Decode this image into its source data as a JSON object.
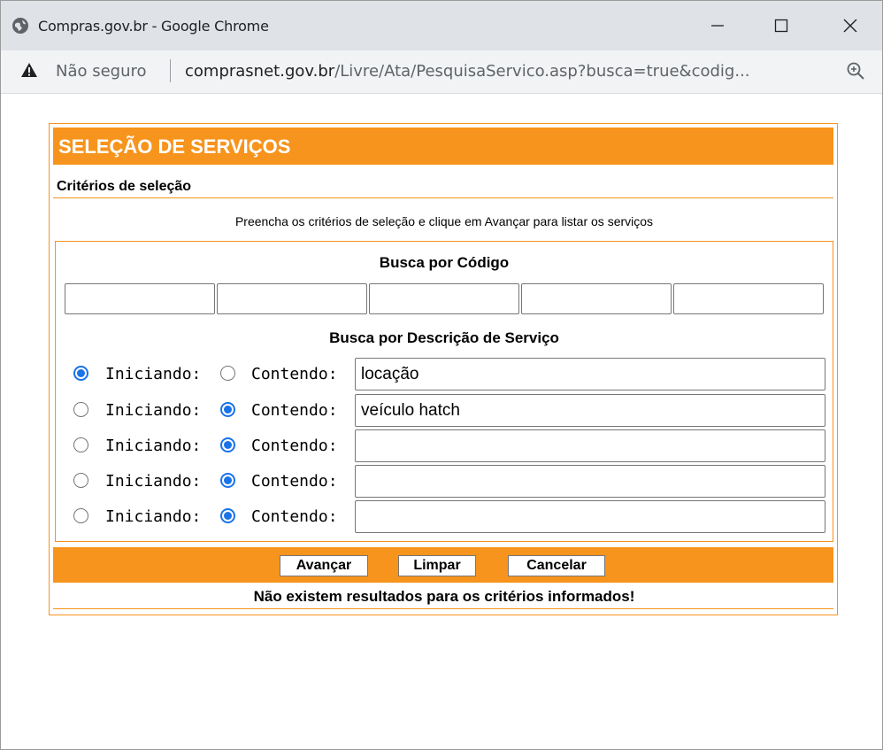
{
  "window": {
    "title": "Compras.gov.br - Google Chrome",
    "minimize_icon": "minimize-icon",
    "maximize_icon": "maximize-icon",
    "close_icon": "close-icon"
  },
  "address_bar": {
    "security_label": "Não seguro",
    "url_host": "comprasnet.gov.br",
    "url_path": "/Livre/Ata/PesquisaServico.asp?busca=true&codig...",
    "zoom_icon": "zoom-icon"
  },
  "form": {
    "header": "SELEÇÃO DE SERVIÇOS",
    "criteria_title": "Critérios de seleção",
    "instructions": "Preencha os critérios de seleção e clique em Avançar para listar os serviços",
    "code_search": {
      "title": "Busca por Código",
      "fields": [
        "",
        "",
        "",
        "",
        ""
      ]
    },
    "description_search": {
      "title": "Busca por Descrição de Serviço",
      "starting_label": "Iniciando:",
      "containing_label": "Contendo:",
      "rows": [
        {
          "mode": "starting",
          "value": "locação"
        },
        {
          "mode": "containing",
          "value": "veículo hatch"
        },
        {
          "mode": "containing",
          "value": ""
        },
        {
          "mode": "containing",
          "value": ""
        },
        {
          "mode": "containing",
          "value": ""
        }
      ]
    },
    "buttons": {
      "advance": "Avançar",
      "clear": "Limpar",
      "cancel": "Cancelar"
    },
    "result_message": "Não existem resultados para os critérios informados!"
  },
  "colors": {
    "accent": "#f7941d",
    "radio_selected": "#1a73e8"
  }
}
